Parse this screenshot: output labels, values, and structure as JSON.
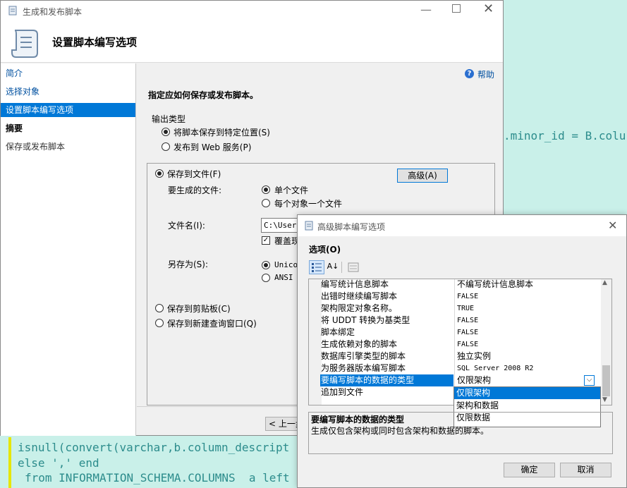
{
  "editor": {
    "line_minor": ".minor_id = B.colu",
    "line_isnull": "isnull(convert(varchar,b.column_descript",
    "line_else": "else ',' end",
    "line_from": "from INFORMATION_SCHEMA.COLUMNS  a left"
  },
  "wizard": {
    "title": "生成和发布脚本",
    "header": "设置脚本编写选项",
    "nav": [
      "简介",
      "选择对象",
      "设置脚本编写选项",
      "摘要",
      "保存或发布脚本"
    ],
    "help": "帮助",
    "instruction": "指定应如何保存或发布脚本。",
    "output_type_label": "输出类型",
    "output_save": "将脚本保存到特定位置(S)",
    "output_publish": "发布到 Web 服务(P)",
    "save_to_file": "保存到文件(F)",
    "advanced": "高级(A)",
    "files_label": "要生成的文件:",
    "single_file": "单个文件",
    "one_per_object": "每个对象一个文件",
    "filename_label": "文件名(I):",
    "filename_value": "C:\\Users",
    "overwrite": "覆盖现",
    "save_as_label": "另存为(S):",
    "unicode": "Unico",
    "ansi": "ANSI T",
    "save_clipboard": "保存到剪贴板(C)",
    "save_query_window": "保存到新建查询窗口(Q)",
    "prev": "< 上一步"
  },
  "advanced_dialog": {
    "title": "高级脚本编写选项",
    "options_label": "选项(O)",
    "properties": [
      {
        "name": "编写统计信息脚本",
        "value": "不编写统计信息脚本"
      },
      {
        "name": "出错时继续编写脚本",
        "value": "FALSE"
      },
      {
        "name": "架构限定对象名称。",
        "value": "TRUE"
      },
      {
        "name": "将 UDDT 转换为基类型",
        "value": "FALSE"
      },
      {
        "name": "脚本绑定",
        "value": "FALSE"
      },
      {
        "name": "生成依赖对象的脚本",
        "value": "FALSE"
      },
      {
        "name": "数据库引擎类型的脚本",
        "value": "独立实例"
      },
      {
        "name": "为服务器版本编写脚本",
        "value": "SQL Server 2008 R2"
      },
      {
        "name": "要编写脚本的数据的类型",
        "value": "仅限架构"
      },
      {
        "name": "追加到文件",
        "value": ""
      }
    ],
    "dropdown_options": [
      "仅限架构",
      "架构和数据",
      "仅限数据"
    ],
    "desc_title": "要编写脚本的数据的类型",
    "desc_text": "生成仅包含架构或同时包含架构和数据的脚本。",
    "ok": "确定",
    "cancel": "取消"
  }
}
